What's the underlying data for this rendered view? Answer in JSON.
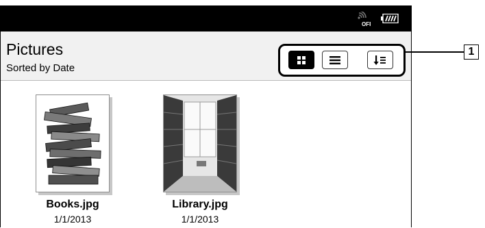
{
  "header": {
    "title": "Pictures",
    "subtitle": "Sorted by Date"
  },
  "status": {
    "wifi_label": "OFF",
    "icons": [
      "wifi-off-icon",
      "battery-icon"
    ]
  },
  "view_buttons": [
    {
      "icon": "thumbnail-grid-icon",
      "active": true
    },
    {
      "icon": "list-view-icon",
      "active": false
    },
    {
      "icon": "sort-icon",
      "active": false
    }
  ],
  "items": [
    {
      "filename": "Books.jpg",
      "date": "1/1/2013",
      "thumbnail": "stack-of-books-photo"
    },
    {
      "filename": "Library.jpg",
      "date": "1/1/2013",
      "thumbnail": "library-aisle-photo"
    }
  ],
  "callout": {
    "label": "1"
  },
  "colors": {
    "statusbar": "#000000",
    "header_bg": "#f1f1f1",
    "background": "#ffffff"
  }
}
